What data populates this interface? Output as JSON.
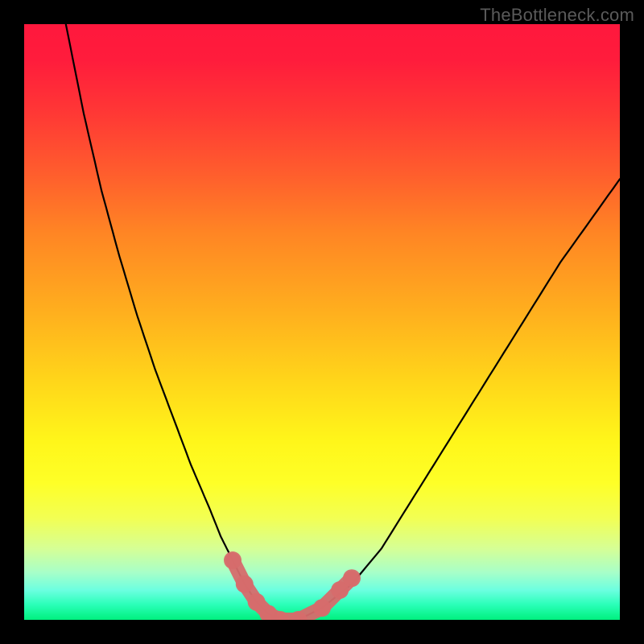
{
  "watermark": "TheBottleneck.com",
  "chart_data": {
    "type": "line",
    "title": "",
    "xlabel": "",
    "ylabel": "",
    "xlim": [
      0,
      100
    ],
    "ylim": [
      0,
      100
    ],
    "grid": false,
    "series": [
      {
        "name": "bottleneck-curve",
        "x": [
          7,
          10,
          13,
          16,
          19,
          22,
          25,
          28,
          31,
          33,
          35,
          37,
          39,
          41,
          43,
          46,
          50,
          55,
          60,
          65,
          70,
          75,
          80,
          85,
          90,
          95,
          100
        ],
        "y": [
          100,
          85,
          72,
          61,
          51,
          42,
          34,
          26,
          19,
          14,
          10,
          6,
          3,
          1,
          0,
          0,
          2,
          6,
          12,
          20,
          28,
          36,
          44,
          52,
          60,
          67,
          74
        ]
      }
    ],
    "highlight": {
      "name": "optimal-range",
      "x": [
        35,
        37,
        39,
        41,
        43,
        46,
        50,
        53,
        55
      ],
      "y": [
        10,
        6,
        3,
        1,
        0,
        0,
        2,
        5,
        7
      ]
    },
    "colors": {
      "curve": "#000000",
      "highlight": "#d66b6b",
      "gradient_top": "#ff183d",
      "gradient_bottom": "#00f07e"
    }
  }
}
